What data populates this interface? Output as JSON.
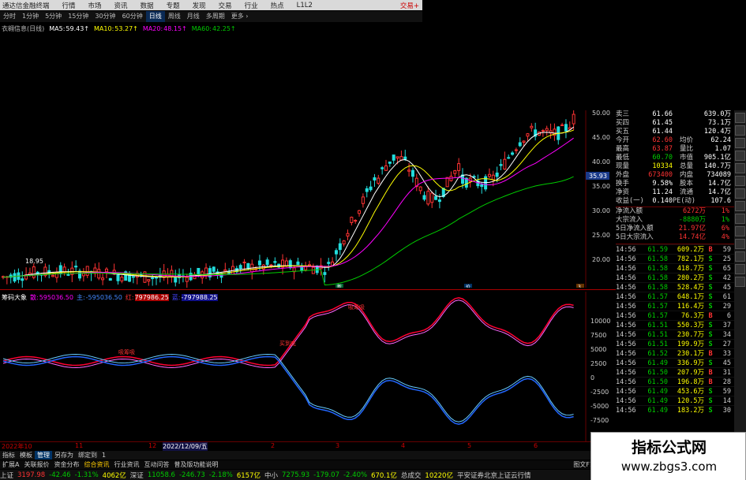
{
  "window": {
    "title": "通达信金融终端",
    "menu": [
      "行情",
      "市场",
      "资讯",
      "数据",
      "专题",
      "发现",
      "交易",
      "行业",
      "热点",
      "L1L2"
    ],
    "right": "交易+"
  },
  "periods": [
    "分时",
    "1分钟",
    "5分钟",
    "15分钟",
    "30分钟",
    "60分钟",
    "日线",
    "周线",
    "月线",
    "多周期",
    "更多 ›"
  ],
  "active_period": "日线",
  "stock_label": "衣翱信息(日线)",
  "ma": [
    {
      "name": "MA5:",
      "val": "59.43↑",
      "color": "#fff"
    },
    {
      "name": "MA10:",
      "val": "53.27↑",
      "color": "#ff0"
    },
    {
      "name": "MA20:",
      "val": "48.15↑",
      "color": "#f0f"
    },
    {
      "name": "MA60:",
      "val": "42.25↑",
      "color": "#0c0"
    }
  ],
  "price_axis": [
    "50.00",
    "45.00",
    "40.00",
    "35.00",
    "30.00",
    "25.00",
    "20.00"
  ],
  "price_marker": "35.93",
  "low_label": "18.95",
  "pt_markers": [
    "新",
    "价",
    "3"
  ],
  "quote": [
    {
      "l": "卖三",
      "v": "61.66",
      "l2": "",
      "v2": "639.0万",
      "vc": "#fff"
    },
    {
      "l": "买四",
      "v": "61.45",
      "l2": "",
      "v2": "73.1万",
      "vc": "#fff"
    },
    {
      "l": "买五",
      "v": "61.44",
      "l2": "",
      "v2": "120.4万",
      "vc": "#fff"
    },
    {
      "l": "今开",
      "v": "62.60",
      "l2": "均价",
      "v2": "62.24",
      "vc": "#f33"
    },
    {
      "l": "最高",
      "v": "63.87",
      "l2": "量比",
      "v2": "1.07",
      "vc": "#f33"
    },
    {
      "l": "最低",
      "v": "60.70",
      "l2": "市值",
      "v2": "905.1亿",
      "vc": "#0c0"
    },
    {
      "l": "现量",
      "v": "10334",
      "l2": "总量",
      "v2": "140.7万",
      "vc": "#ff0"
    },
    {
      "l": "外盘",
      "v": "673400",
      "l2": "内盘",
      "v2": "734089",
      "vc": "#f33"
    },
    {
      "l": "换手",
      "v": "9.58%",
      "l2": "股本",
      "v2": "14.7亿",
      "vc": "#fff"
    },
    {
      "l": "净资",
      "v": "11.24",
      "l2": "流通",
      "v2": "14.7亿",
      "vc": "#fff"
    },
    {
      "l": "收益(一)",
      "v": "0.140",
      "l2": "PE(动)",
      "v2": "107.6",
      "vc": "#fff"
    }
  ],
  "flow": [
    {
      "l": "净流入额",
      "v": "6272万",
      "p": "1%",
      "c": "#f33"
    },
    {
      "l": "大宗流入",
      "v": "-8880万",
      "p": "1%",
      "c": "#0c0"
    },
    {
      "l": "5日净流入额",
      "v": "21.97亿",
      "p": "6%",
      "c": "#f33"
    },
    {
      "l": "5日大宗流入",
      "v": "14.74亿",
      "p": "4%",
      "c": "#f33"
    }
  ],
  "ticks": [
    {
      "t": "14:56",
      "p": "61.59",
      "q": "609.2万",
      "d": "B",
      "dc": "#f33",
      "n": "59"
    },
    {
      "t": "14:56",
      "p": "61.58",
      "q": "782.1万",
      "d": "S",
      "dc": "#0c0",
      "n": "25"
    },
    {
      "t": "14:56",
      "p": "61.58",
      "q": "418.7万",
      "d": "S",
      "dc": "#0c0",
      "n": "65"
    },
    {
      "t": "14:56",
      "p": "61.58",
      "q": "280.2万",
      "d": "S",
      "dc": "#0c0",
      "n": "42"
    },
    {
      "t": "14:56",
      "p": "61.58",
      "q": "528.4万",
      "d": "S",
      "dc": "#0c0",
      "n": "45"
    },
    {
      "t": "14:56",
      "p": "61.57",
      "q": "648.1万",
      "d": "S",
      "dc": "#0c0",
      "n": "61"
    },
    {
      "t": "14:56",
      "p": "61.57",
      "q": "116.4万",
      "d": "S",
      "dc": "#0c0",
      "n": "29"
    },
    {
      "t": "14:56",
      "p": "61.57",
      "q": "76.3万",
      "d": "B",
      "dc": "#f33",
      "n": "6"
    },
    {
      "t": "14:56",
      "p": "61.51",
      "q": "550.3万",
      "d": "S",
      "dc": "#0c0",
      "n": "37"
    },
    {
      "t": "14:56",
      "p": "61.51",
      "q": "230.7万",
      "d": "S",
      "dc": "#0c0",
      "n": "34"
    },
    {
      "t": "14:56",
      "p": "61.51",
      "q": "199.9万",
      "d": "S",
      "dc": "#0c0",
      "n": "27"
    },
    {
      "t": "14:56",
      "p": "61.52",
      "q": "230.1万",
      "d": "B",
      "dc": "#f33",
      "n": "33"
    },
    {
      "t": "14:56",
      "p": "61.49",
      "q": "336.9万",
      "d": "S",
      "dc": "#0c0",
      "n": "45"
    },
    {
      "t": "14:56",
      "p": "61.50",
      "q": "207.9万",
      "d": "B",
      "dc": "#f33",
      "n": "31"
    },
    {
      "t": "14:56",
      "p": "61.50",
      "q": "196.8万",
      "d": "B",
      "dc": "#f33",
      "n": "28"
    },
    {
      "t": "14:56",
      "p": "61.49",
      "q": "453.6万",
      "d": "S",
      "dc": "#0c0",
      "n": "59"
    },
    {
      "t": "14:56",
      "p": "61.49",
      "q": "120.5万",
      "d": "S",
      "dc": "#0c0",
      "n": "14"
    },
    {
      "t": "14:56",
      "p": "61.49",
      "q": "183.2万",
      "d": "S",
      "dc": "#0c0",
      "n": "30"
    }
  ],
  "indicator": {
    "name": "筹码大象",
    "items": [
      {
        "k": "散:",
        "v": "595036.50",
        "c": "#f0f"
      },
      {
        "k": "主:",
        "v": "-595036.50",
        "c": "#48f"
      },
      {
        "k": "红:",
        "v": "797986.25",
        "c": "#f33"
      },
      {
        "k": "蓝:",
        "v": "-797988.25",
        "c": "#44f"
      }
    ],
    "axis": [
      "10000",
      "7500",
      "5000",
      "2500",
      "0",
      "-2500",
      "-5000",
      "-7500",
      "-10000"
    ],
    "labels": [
      "买到底",
      "吸筹吸",
      "吸筹吸"
    ]
  },
  "bottom_axis": [
    "2022年10",
    "11",
    "12",
    "2022/12/09/五",
    "2",
    "3",
    "4",
    "5",
    "6"
  ],
  "tabs": [
    "指标",
    "模板",
    "管理",
    "另存为",
    "绑定到",
    "1"
  ],
  "tabs2": [
    "扩展A",
    "关联报价",
    "资金分布",
    "综合资讯",
    "行业资讯",
    "互动问答",
    "普及版功能说明"
  ],
  "status_right": "图文F10",
  "status": [
    {
      "t": "上证",
      "c": "#ccc"
    },
    {
      "t": "3197.98",
      "c": "#f33"
    },
    {
      "t": "-42.46",
      "c": "#0c0"
    },
    {
      "t": "-1.31%",
      "c": "#0c0"
    },
    {
      "t": "4062亿",
      "c": "#ff0"
    },
    {
      "t": "深证",
      "c": "#ccc"
    },
    {
      "t": "11058.6",
      "c": "#0c0"
    },
    {
      "t": "-246.73",
      "c": "#0c0"
    },
    {
      "t": "-2.18%",
      "c": "#0c0"
    },
    {
      "t": "6157亿",
      "c": "#ff0"
    },
    {
      "t": "中小",
      "c": "#ccc"
    },
    {
      "t": "7275.93",
      "c": "#0c0"
    },
    {
      "t": "-179.07",
      "c": "#0c0"
    },
    {
      "t": "-2.40%",
      "c": "#0c0"
    },
    {
      "t": "670.1亿",
      "c": "#ff0"
    },
    {
      "t": "总成交",
      "c": "#ccc"
    },
    {
      "t": "10220亿",
      "c": "#ff0"
    },
    {
      "t": "平安证券北京上证云行情",
      "c": "#ccc"
    }
  ],
  "watermark": {
    "title": "指标公式网",
    "url": "www.zbgs3.com"
  }
}
